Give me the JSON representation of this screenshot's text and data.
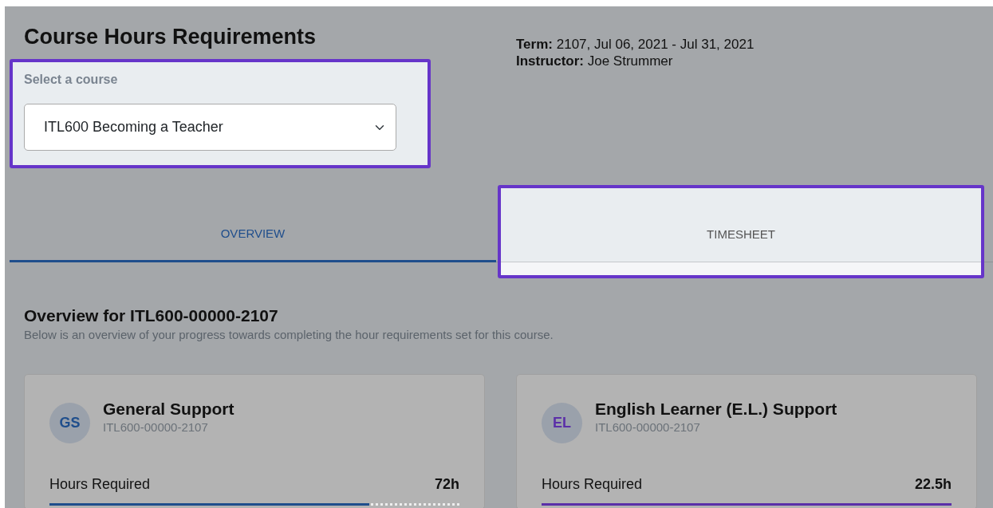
{
  "page": {
    "title": "Course Hours Requirements"
  },
  "course_select": {
    "label": "Select a course",
    "value": "ITL600 Becoming a Teacher",
    "highlighted": true
  },
  "term_info": [
    {
      "label": "Term:",
      "value": "2107, Jul 06, 2021 - Jul 31, 2021"
    },
    {
      "label": "Instructor:",
      "value": "Joe Strummer"
    }
  ],
  "tabs": [
    {
      "label": "OVERVIEW",
      "selected": true,
      "highlighted": false
    },
    {
      "label": "TIMESHEET",
      "selected": false,
      "highlighted": true
    }
  ],
  "overview": {
    "title": "Overview for ITL600-00000-2107",
    "subtitle": "Below is an overview of your progress towards completing the hour requirements set for this course."
  },
  "cards": [
    {
      "initials": "GS",
      "title": "General Support",
      "code": "ITL600-00000-2107",
      "color": "#1f4e8c",
      "metric_label": "Hours Required",
      "metric_value": "72h",
      "level": 0.78
    },
    {
      "initials": "EL",
      "title": "English Learner (E.L.) Support",
      "code": "ITL600-00000-2107",
      "color": "#5b2fa8",
      "metric_label": "Hours Required",
      "metric_value": "22.5h",
      "level": 1.0
    }
  ]
}
